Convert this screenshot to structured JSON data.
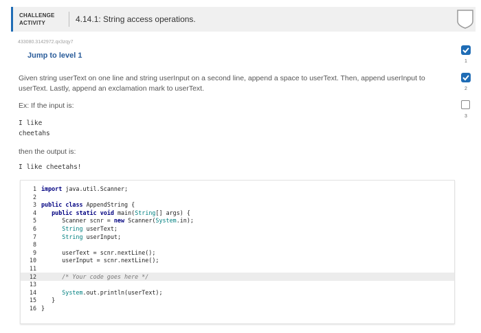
{
  "header": {
    "category_line1": "CHALLENGE",
    "category_line2": "ACTIVITY",
    "title": "4.14.1: String access operations."
  },
  "meta_id": "433080.3142972.qx3zqy7",
  "jump_label": "Jump to level 1",
  "instructions": "Given string userText on one line and string userInput on a second line, append a space to userText. Then, append userInput to userText. Lastly, append an exclamation mark to userText.",
  "example_label": "Ex: If the input is:",
  "example_input": [
    "I like",
    "cheetahs"
  ],
  "output_label": "then the output is:",
  "example_output": "I like cheetahs!",
  "code_lines": [
    {
      "n": "1",
      "text": "import java.util.Scanner;"
    },
    {
      "n": "2",
      "text": ""
    },
    {
      "n": "3",
      "text": "public class AppendString {"
    },
    {
      "n": "4",
      "text": "   public static void main(String[] args) {"
    },
    {
      "n": "5",
      "text": "      Scanner scnr = new Scanner(System.in);"
    },
    {
      "n": "6",
      "text": "      String userText;"
    },
    {
      "n": "7",
      "text": "      String userInput;"
    },
    {
      "n": "8",
      "text": ""
    },
    {
      "n": "9",
      "text": "      userText = scnr.nextLine();"
    },
    {
      "n": "10",
      "text": "      userInput = scnr.nextLine();"
    },
    {
      "n": "11",
      "text": ""
    },
    {
      "n": "12",
      "text": "      /* Your code goes here */"
    },
    {
      "n": "13",
      "text": ""
    },
    {
      "n": "14",
      "text": "      System.out.println(userText);"
    },
    {
      "n": "15",
      "text": "   }"
    },
    {
      "n": "16",
      "text": "}"
    }
  ],
  "levels": [
    {
      "num": "1",
      "state": "done"
    },
    {
      "num": "2",
      "state": "done"
    },
    {
      "num": "3",
      "state": "todo"
    }
  ],
  "colors": {
    "accent": "#1f6cb5",
    "link": "#2a5c9a"
  }
}
